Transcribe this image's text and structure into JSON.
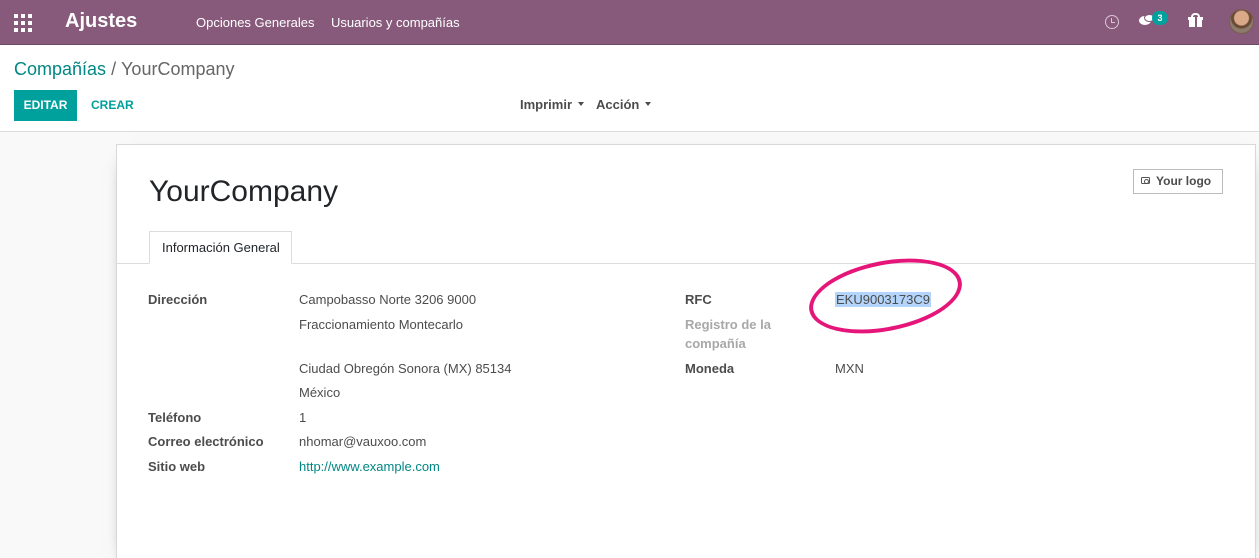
{
  "navbar": {
    "app_title": "Ajustes",
    "menu": [
      "Opciones Generales",
      "Usuarios y compañías"
    ],
    "message_count": "3",
    "accent_color": "#875a7b"
  },
  "breadcrumb": {
    "parent": "Compañías",
    "separator": "/",
    "current": "YourCompany"
  },
  "toolbar": {
    "edit_label": "EDITAR",
    "create_label": "CREAR",
    "print_label": "Imprimir",
    "action_label": "Acción",
    "primary_color": "#00a09d"
  },
  "form": {
    "company_name": "YourCompany",
    "logo_button": "Your logo",
    "tab_label": "Información General",
    "fields": {
      "address_label": "Dirección",
      "address_line1": "Campobasso Norte  3206  9000",
      "address_line2": "Fraccionamiento Montecarlo",
      "address_line3": "Ciudad Obregón  Sonora (MX)  85134",
      "address_line4": "México",
      "phone_label": "Teléfono",
      "phone_value": "1",
      "email_label": "Correo electrónico",
      "email_value": "nhomar@vauxoo.com",
      "website_label": "Sitio web",
      "website_value": "http://www.example.com",
      "rfc_label": "RFC",
      "rfc_value": "EKU9003173C9",
      "registry_label_1": "Registro de la",
      "registry_label_2": "compañía",
      "currency_label": "Moneda",
      "currency_value": "MXN"
    }
  },
  "annotation": {
    "highlight_color": "#e5157a"
  }
}
